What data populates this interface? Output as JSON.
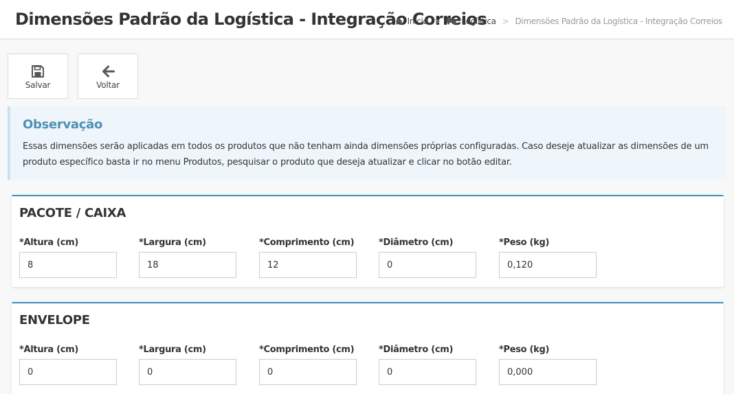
{
  "header": {
    "title": "Dimensões Padrão da Logística - Integração Correios",
    "breadcrumb": [
      {
        "label": "Início",
        "icon": "home-icon"
      },
      {
        "label": "Logística",
        "icon": "truck-icon"
      },
      {
        "label": "Dimensões Padrão da Logística - Integração Correios"
      }
    ],
    "separator": ">"
  },
  "toolbar": {
    "save_label": "Salvar",
    "back_label": "Voltar"
  },
  "note": {
    "title": "Observação",
    "text": "Essas dimensões serão aplicadas em todos os produtos que não tenham ainda dimensões próprias configuradas. Caso deseje atualizar as dimensões de um produto específico basta ir no menu Produtos, pesquisar o produto que deseja atualizar e clicar no botão editar."
  },
  "sections": [
    {
      "title": "PACOTE / CAIXA",
      "fields": [
        {
          "label": "*Altura (cm)",
          "value": "8"
        },
        {
          "label": "*Largura (cm)",
          "value": "18"
        },
        {
          "label": "*Comprimento (cm)",
          "value": "12"
        },
        {
          "label": "*Diâmetro (cm)",
          "value": "0"
        },
        {
          "label": "*Peso (kg)",
          "value": "0,120"
        }
      ]
    },
    {
      "title": "ENVELOPE",
      "fields": [
        {
          "label": "*Altura (cm)",
          "value": "0"
        },
        {
          "label": "*Largura (cm)",
          "value": "0"
        },
        {
          "label": "*Comprimento (cm)",
          "value": "0"
        },
        {
          "label": "*Diâmetro (cm)",
          "value": "0"
        },
        {
          "label": "*Peso (kg)",
          "value": "0,000"
        }
      ]
    }
  ],
  "colors": {
    "accent": "#3c8dbc",
    "note_background": "#eef6fc",
    "note_title": "#4e8fb3"
  }
}
